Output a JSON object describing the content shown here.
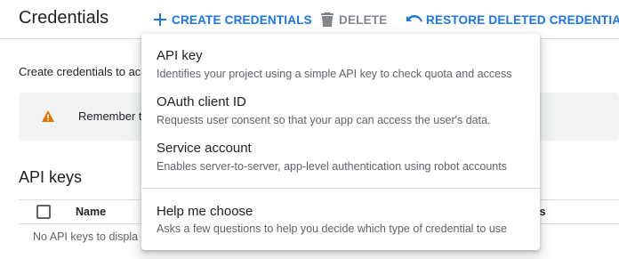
{
  "header": {
    "title": "Credentials",
    "create_label": "CREATE CREDENTIALS",
    "delete_label": "DELETE",
    "restore_label": "RESTORE DELETED CREDENTIALS"
  },
  "main": {
    "intro": "Create credentials to acc",
    "notice_text": "Remember t",
    "section_title": "API keys",
    "table": {
      "columns": [
        "Name",
        "ns"
      ],
      "empty_text": "No API keys to displa"
    }
  },
  "menu": {
    "items": [
      {
        "label": "API key",
        "description": "Identifies your project using a simple API key to check quota and access"
      },
      {
        "label": "OAuth client ID",
        "description": "Requests user consent so that your app can access the user's data."
      },
      {
        "label": "Service account",
        "description": "Enables server-to-server, app-level authentication using robot accounts"
      },
      {
        "label": "Help me choose",
        "description": "Asks a few questions to help you decide which type of credential to use"
      }
    ]
  },
  "colors": {
    "accent": "#1a73e8",
    "disabled": "#80868b",
    "warning": "#e37400",
    "notice_bg": "#f1f3f4"
  },
  "icons": {
    "create": "plus-icon",
    "delete": "trash-icon",
    "restore": "undo-icon",
    "notice": "warning-icon"
  }
}
